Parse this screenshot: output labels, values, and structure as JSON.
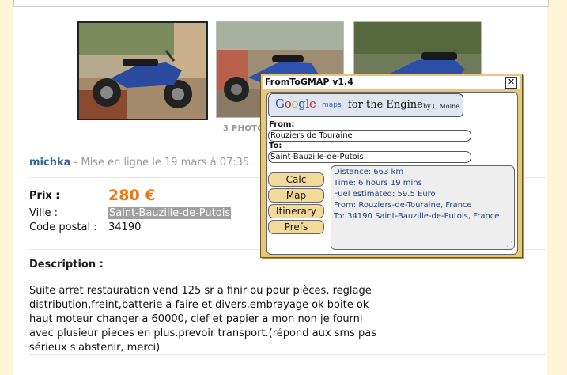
{
  "photos": {
    "count_label": "3 PHOTO",
    "items": [
      "photo-1",
      "photo-2",
      "photo-3"
    ]
  },
  "listing": {
    "author": "michka",
    "posted": " - Mise en ligne le 19 mars à 07:35.",
    "price_label": "Prix :",
    "price": "280 €",
    "city_label": "Ville :",
    "city": "Saint-Bauzille-de-Putois",
    "postcode_label": "Code postal :",
    "postcode": "34190",
    "description_label": "Description :",
    "description": "Suite arret restauration vend 125 sr a finir ou pour pièces, reglage distribution,freint,batterie a faire et divers.embrayage ok boite ok haut moteur changer a 60000, clef et papier a mon non je fourni avec plusieur pieces en plus.prevoir transport.(répond aux sms pas sérieux s'abstenir, merci)"
  },
  "popup": {
    "title": "FromToGMAP v1.4",
    "close": "✕",
    "google": "Google",
    "maps": "maps",
    "engine": "for the Engine",
    "by": "by C.Moine",
    "from_label": "From:",
    "from_value": "Rouziers de Touraine",
    "to_label": "To:",
    "to_value": "Saint-Bauzille-de-Putois",
    "buttons": {
      "calc": "Calc",
      "map": "Map",
      "itinerary": "Itinerary",
      "prefs": "Prefs"
    },
    "result": {
      "distance": "Distance: 663 km",
      "time": "Time: 6 hours 19 mins",
      "fuel": "Fuel estimated: 59.5 Euro",
      "from": "From: Rouziers-de-Touraine, France",
      "to": "To: 34190 Saint-Bauzille-de-Putois, France"
    }
  },
  "colors": {
    "price": "#ee7711",
    "author": "#336699",
    "popup_bg": "#e8c878",
    "button_bg": "#f3d99a",
    "result_text": "#224488"
  }
}
